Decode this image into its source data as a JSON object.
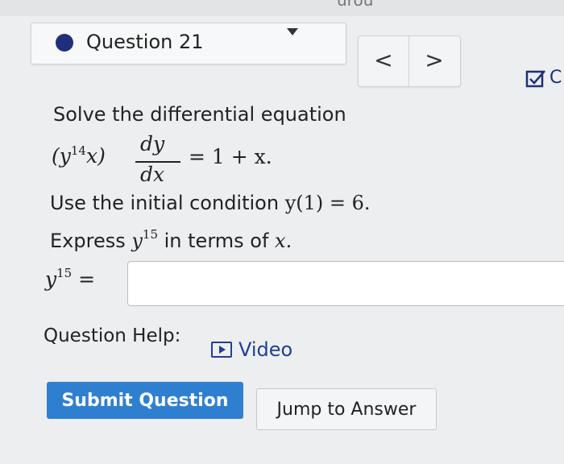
{
  "header": {
    "top_fragment": "urou",
    "question_title": "Question 21"
  },
  "nav": {
    "prev": "<",
    "next": ">"
  },
  "toolbar": {
    "c_fragment": "C"
  },
  "problem": {
    "prompt": "Solve the differential equation",
    "eq_lhs_base": "(y",
    "eq_lhs_exp": "14",
    "eq_lhs_tail": "x)",
    "eq_numerator": "dy",
    "eq_denominator": "dx",
    "eq_rhs": "= 1 + x.",
    "initial_text": "Use the initial condition ",
    "initial_math": "y(1) = 6.",
    "express_text": "Express ",
    "express_base": "y",
    "express_exp": "15",
    "express_tail": " in terms of ",
    "express_var": "x."
  },
  "answer": {
    "label_base": "y",
    "label_exp": "15",
    "label_eq": " =",
    "value": ""
  },
  "help": {
    "label": "Question Help:",
    "video_label": "Video"
  },
  "actions": {
    "submit_label": "Submit Question",
    "jump_label": "Jump to Answer"
  }
}
